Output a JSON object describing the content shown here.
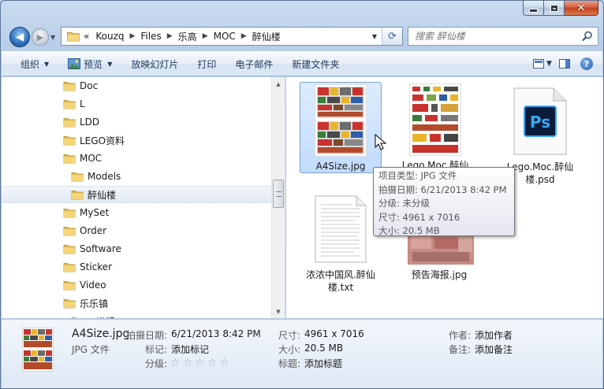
{
  "window": {
    "caption_buttons": {
      "minimize": "minimize-icon",
      "maximize": "maximize-icon",
      "close": "close-icon"
    }
  },
  "address_bar": {
    "overflow": "«",
    "crumbs": [
      "Kouzq",
      "Files",
      "乐高",
      "MOC",
      "醉仙楼"
    ],
    "search_placeholder": "搜索 醉仙楼"
  },
  "commands": {
    "organize": "组织",
    "preview": "预览",
    "slideshow": "放映幻灯片",
    "print": "打印",
    "email": "电子邮件",
    "new_folder": "新建文件夹"
  },
  "nav_tree": [
    {
      "label": "Doc",
      "indent": 0
    },
    {
      "label": "L",
      "indent": 0
    },
    {
      "label": "LDD",
      "indent": 0
    },
    {
      "label": "LEGO资料",
      "indent": 0
    },
    {
      "label": "MOC",
      "indent": 0
    },
    {
      "label": "Models",
      "indent": 1
    },
    {
      "label": "醉仙楼",
      "indent": 1,
      "selected": true
    },
    {
      "label": "MySet",
      "indent": 0
    },
    {
      "label": "Order",
      "indent": 0
    },
    {
      "label": "Software",
      "indent": 0
    },
    {
      "label": "Sticker",
      "indent": 0
    },
    {
      "label": "Video",
      "indent": 0
    },
    {
      "label": "乐乐镇",
      "indent": 0
    },
    {
      "label": "PI说明",
      "indent": 1
    }
  ],
  "files": [
    {
      "name": "A4Size.jpg",
      "selected": true
    },
    {
      "name": "Lego.Moc.醉仙"
    },
    {
      "name": "Lego.Moc.醉仙楼.psd"
    },
    {
      "name": "浓浓中国风.醉仙楼.txt"
    },
    {
      "name": "预告海报.jpg"
    }
  ],
  "tooltip": {
    "lines": [
      "项目类型: JPG 文件",
      "拍摄日期: 6/21/2013 8:42 PM",
      "分级: 未分级",
      "尺寸: 4961 x 7016",
      "大小: 20.5 MB"
    ]
  },
  "details": {
    "name": "A4Size.jpg",
    "type": "JPG 文件",
    "date_label": "拍摄日期:",
    "date_value": "6/21/2013 8:42 PM",
    "tags_label": "标记:",
    "tags_value": "添加标记",
    "rating_label": "分级:",
    "rating_stars": 0,
    "dims_label": "尺寸:",
    "dims_value": "4961 x 7016",
    "size_label": "大小:",
    "size_value": "20.5 MB",
    "title_label": "标题:",
    "title_value": "添加标题",
    "author_label": "作者:",
    "author_value": "添加作者",
    "comment_label": "备注:",
    "comment_value": "添加备注"
  }
}
